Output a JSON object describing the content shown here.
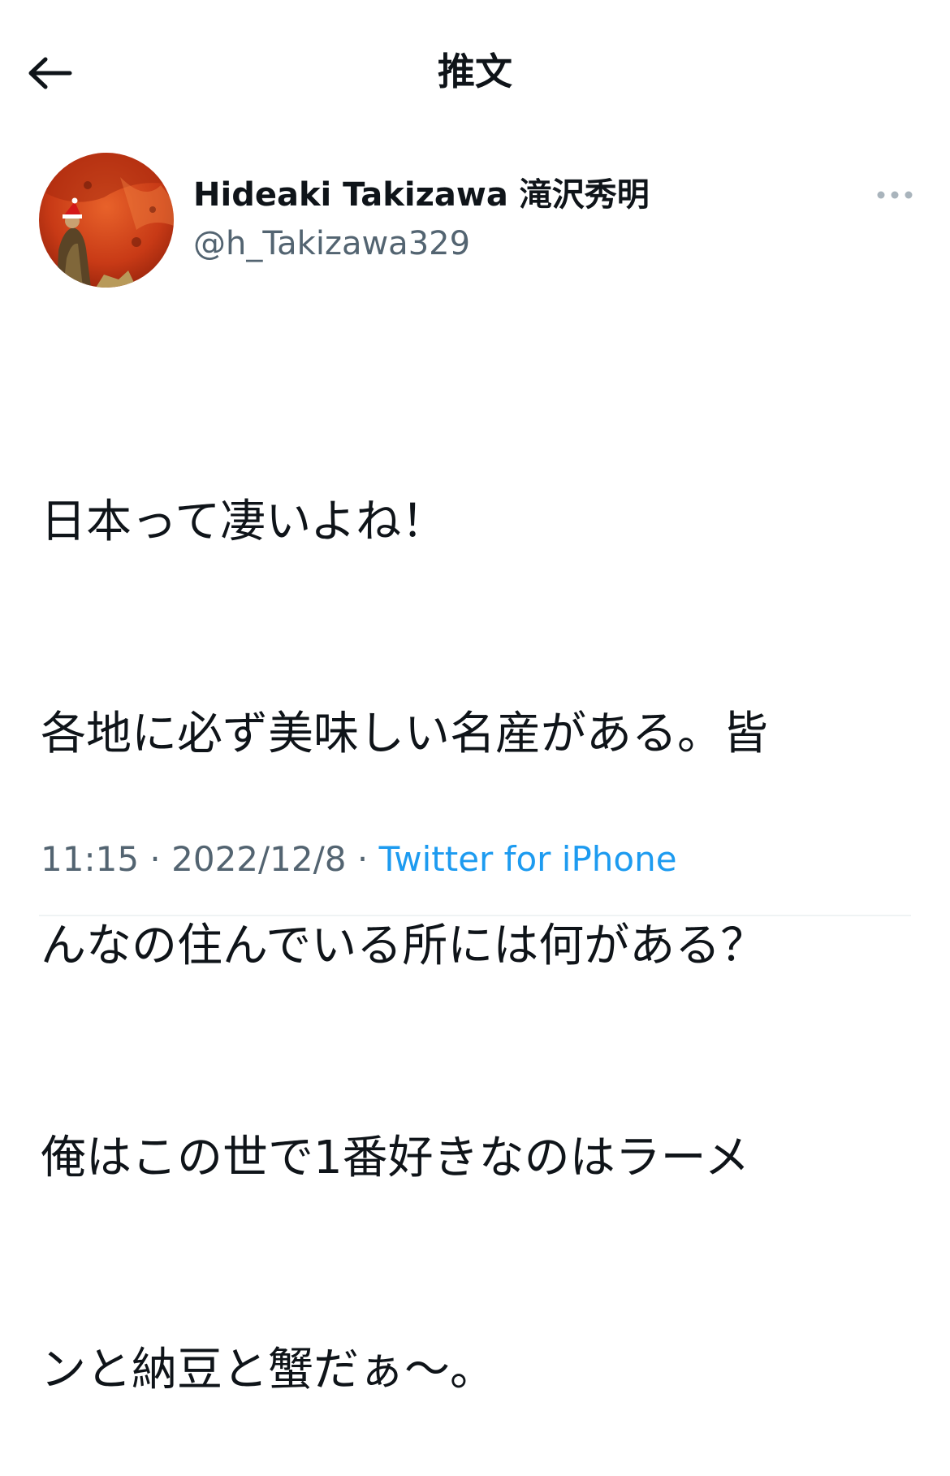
{
  "header": {
    "back_icon": "arrow-left-icon",
    "title": "推文"
  },
  "author": {
    "display_name": "Hideaki Takizawa 滝沢秀明",
    "handle": "@h_Takizawa329",
    "more_icon": "more-horizontal-icon"
  },
  "tweet": {
    "lines": [
      "日本って凄いよね！",
      "各地に必ず美味しい名産がある。皆",
      "んなの住んでいる所には何がある？",
      "俺はこの世で1番好きなのはラーメ",
      "ンと納豆と蟹だぁ〜。"
    ],
    "time": "11:15",
    "separator": "·",
    "date": "2022/12/8",
    "source": "Twitter for iPhone"
  },
  "colors": {
    "text_primary": "#0f1419",
    "text_secondary": "#536471",
    "link": "#1d9bf0",
    "divider": "#eff3f4"
  }
}
